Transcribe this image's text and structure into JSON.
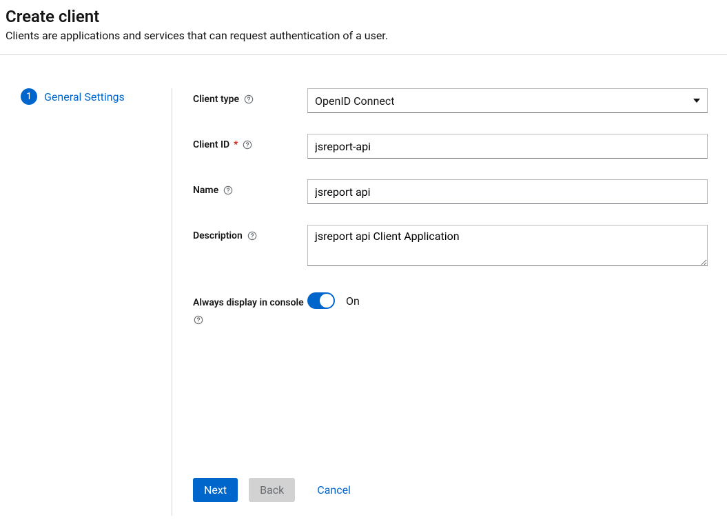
{
  "header": {
    "title": "Create client",
    "subtitle": "Clients are applications and services that can request authentication of a user."
  },
  "wizard": {
    "step1_number": "1",
    "step1_label": "General Settings"
  },
  "form": {
    "client_type": {
      "label": "Client type",
      "value": "OpenID Connect"
    },
    "client_id": {
      "label": "Client ID",
      "required_mark": "*",
      "value": "jsreport-api"
    },
    "name": {
      "label": "Name",
      "value": "jsreport api"
    },
    "description": {
      "label": "Description",
      "value": "jsreport api Client Application"
    },
    "always_display": {
      "label": "Always display in console",
      "state_label": "On"
    }
  },
  "footer": {
    "next": "Next",
    "back": "Back",
    "cancel": "Cancel"
  }
}
